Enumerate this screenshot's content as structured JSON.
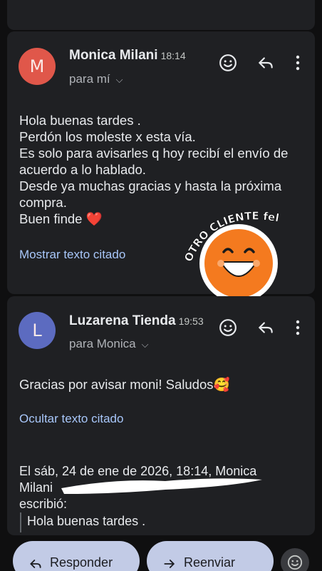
{
  "messages": [
    {
      "avatar_letter": "M",
      "avatar_color": "#e0574a",
      "sender": "Monica Milani",
      "time": "18:14",
      "recipient": "para mí",
      "body": [
        "Hola buenas tardes .",
        "Perdón los moleste x esta vía.",
        "Es solo para avisarles q hoy recibí el envío de",
        "acuerdo a lo hablado.",
        "Desde ya muchas gracias y hasta la próxima",
        "compra.",
        "Buen finde ❤️"
      ],
      "quoted_link": "Mostrar texto citado"
    },
    {
      "avatar_letter": "L",
      "avatar_color": "#5c6bc0",
      "sender": "Luzarena Tienda",
      "time": "19:53",
      "recipient": "para Monica",
      "body": [
        "Gracias por avisar moni! Saludos🥰"
      ],
      "quoted_link": "Ocultar texto citado",
      "quote_header": [
        "El sáb, 24 de ene de 2026, 18:14, Monica",
        "Milani",
        "escribió:"
      ],
      "quote_body": "Hola buenas tardes ."
    }
  ],
  "sticker": {
    "text": "OTRO CLIENTE feliz",
    "face_color": "#f47a1f"
  },
  "actions": {
    "reply": "Responder",
    "forward": "Reenviar"
  },
  "colors": {
    "background": "#0f0f10",
    "card": "#1f2023",
    "link": "#a8c7fa",
    "pill": "#c2cbe6"
  }
}
